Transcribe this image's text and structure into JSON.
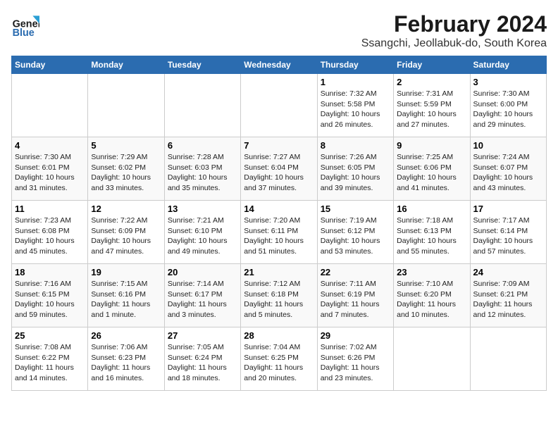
{
  "header": {
    "logo_line1": "General",
    "logo_line2": "Blue",
    "title": "February 2024",
    "subtitle": "Ssangchi, Jeollabuk-do, South Korea"
  },
  "calendar": {
    "days_of_week": [
      "Sunday",
      "Monday",
      "Tuesday",
      "Wednesday",
      "Thursday",
      "Friday",
      "Saturday"
    ],
    "weeks": [
      [
        {
          "day": "",
          "sunrise": "",
          "sunset": "",
          "daylight": ""
        },
        {
          "day": "",
          "sunrise": "",
          "sunset": "",
          "daylight": ""
        },
        {
          "day": "",
          "sunrise": "",
          "sunset": "",
          "daylight": ""
        },
        {
          "day": "",
          "sunrise": "",
          "sunset": "",
          "daylight": ""
        },
        {
          "day": "1",
          "sunrise": "Sunrise: 7:32 AM",
          "sunset": "Sunset: 5:58 PM",
          "daylight": "Daylight: 10 hours and 26 minutes."
        },
        {
          "day": "2",
          "sunrise": "Sunrise: 7:31 AM",
          "sunset": "Sunset: 5:59 PM",
          "daylight": "Daylight: 10 hours and 27 minutes."
        },
        {
          "day": "3",
          "sunrise": "Sunrise: 7:30 AM",
          "sunset": "Sunset: 6:00 PM",
          "daylight": "Daylight: 10 hours and 29 minutes."
        }
      ],
      [
        {
          "day": "4",
          "sunrise": "Sunrise: 7:30 AM",
          "sunset": "Sunset: 6:01 PM",
          "daylight": "Daylight: 10 hours and 31 minutes."
        },
        {
          "day": "5",
          "sunrise": "Sunrise: 7:29 AM",
          "sunset": "Sunset: 6:02 PM",
          "daylight": "Daylight: 10 hours and 33 minutes."
        },
        {
          "day": "6",
          "sunrise": "Sunrise: 7:28 AM",
          "sunset": "Sunset: 6:03 PM",
          "daylight": "Daylight: 10 hours and 35 minutes."
        },
        {
          "day": "7",
          "sunrise": "Sunrise: 7:27 AM",
          "sunset": "Sunset: 6:04 PM",
          "daylight": "Daylight: 10 hours and 37 minutes."
        },
        {
          "day": "8",
          "sunrise": "Sunrise: 7:26 AM",
          "sunset": "Sunset: 6:05 PM",
          "daylight": "Daylight: 10 hours and 39 minutes."
        },
        {
          "day": "9",
          "sunrise": "Sunrise: 7:25 AM",
          "sunset": "Sunset: 6:06 PM",
          "daylight": "Daylight: 10 hours and 41 minutes."
        },
        {
          "day": "10",
          "sunrise": "Sunrise: 7:24 AM",
          "sunset": "Sunset: 6:07 PM",
          "daylight": "Daylight: 10 hours and 43 minutes."
        }
      ],
      [
        {
          "day": "11",
          "sunrise": "Sunrise: 7:23 AM",
          "sunset": "Sunset: 6:08 PM",
          "daylight": "Daylight: 10 hours and 45 minutes."
        },
        {
          "day": "12",
          "sunrise": "Sunrise: 7:22 AM",
          "sunset": "Sunset: 6:09 PM",
          "daylight": "Daylight: 10 hours and 47 minutes."
        },
        {
          "day": "13",
          "sunrise": "Sunrise: 7:21 AM",
          "sunset": "Sunset: 6:10 PM",
          "daylight": "Daylight: 10 hours and 49 minutes."
        },
        {
          "day": "14",
          "sunrise": "Sunrise: 7:20 AM",
          "sunset": "Sunset: 6:11 PM",
          "daylight": "Daylight: 10 hours and 51 minutes."
        },
        {
          "day": "15",
          "sunrise": "Sunrise: 7:19 AM",
          "sunset": "Sunset: 6:12 PM",
          "daylight": "Daylight: 10 hours and 53 minutes."
        },
        {
          "day": "16",
          "sunrise": "Sunrise: 7:18 AM",
          "sunset": "Sunset: 6:13 PM",
          "daylight": "Daylight: 10 hours and 55 minutes."
        },
        {
          "day": "17",
          "sunrise": "Sunrise: 7:17 AM",
          "sunset": "Sunset: 6:14 PM",
          "daylight": "Daylight: 10 hours and 57 minutes."
        }
      ],
      [
        {
          "day": "18",
          "sunrise": "Sunrise: 7:16 AM",
          "sunset": "Sunset: 6:15 PM",
          "daylight": "Daylight: 10 hours and 59 minutes."
        },
        {
          "day": "19",
          "sunrise": "Sunrise: 7:15 AM",
          "sunset": "Sunset: 6:16 PM",
          "daylight": "Daylight: 11 hours and 1 minute."
        },
        {
          "day": "20",
          "sunrise": "Sunrise: 7:14 AM",
          "sunset": "Sunset: 6:17 PM",
          "daylight": "Daylight: 11 hours and 3 minutes."
        },
        {
          "day": "21",
          "sunrise": "Sunrise: 7:12 AM",
          "sunset": "Sunset: 6:18 PM",
          "daylight": "Daylight: 11 hours and 5 minutes."
        },
        {
          "day": "22",
          "sunrise": "Sunrise: 7:11 AM",
          "sunset": "Sunset: 6:19 PM",
          "daylight": "Daylight: 11 hours and 7 minutes."
        },
        {
          "day": "23",
          "sunrise": "Sunrise: 7:10 AM",
          "sunset": "Sunset: 6:20 PM",
          "daylight": "Daylight: 11 hours and 10 minutes."
        },
        {
          "day": "24",
          "sunrise": "Sunrise: 7:09 AM",
          "sunset": "Sunset: 6:21 PM",
          "daylight": "Daylight: 11 hours and 12 minutes."
        }
      ],
      [
        {
          "day": "25",
          "sunrise": "Sunrise: 7:08 AM",
          "sunset": "Sunset: 6:22 PM",
          "daylight": "Daylight: 11 hours and 14 minutes."
        },
        {
          "day": "26",
          "sunrise": "Sunrise: 7:06 AM",
          "sunset": "Sunset: 6:23 PM",
          "daylight": "Daylight: 11 hours and 16 minutes."
        },
        {
          "day": "27",
          "sunrise": "Sunrise: 7:05 AM",
          "sunset": "Sunset: 6:24 PM",
          "daylight": "Daylight: 11 hours and 18 minutes."
        },
        {
          "day": "28",
          "sunrise": "Sunrise: 7:04 AM",
          "sunset": "Sunset: 6:25 PM",
          "daylight": "Daylight: 11 hours and 20 minutes."
        },
        {
          "day": "29",
          "sunrise": "Sunrise: 7:02 AM",
          "sunset": "Sunset: 6:26 PM",
          "daylight": "Daylight: 11 hours and 23 minutes."
        },
        {
          "day": "",
          "sunrise": "",
          "sunset": "",
          "daylight": ""
        },
        {
          "day": "",
          "sunrise": "",
          "sunset": "",
          "daylight": ""
        }
      ]
    ]
  }
}
